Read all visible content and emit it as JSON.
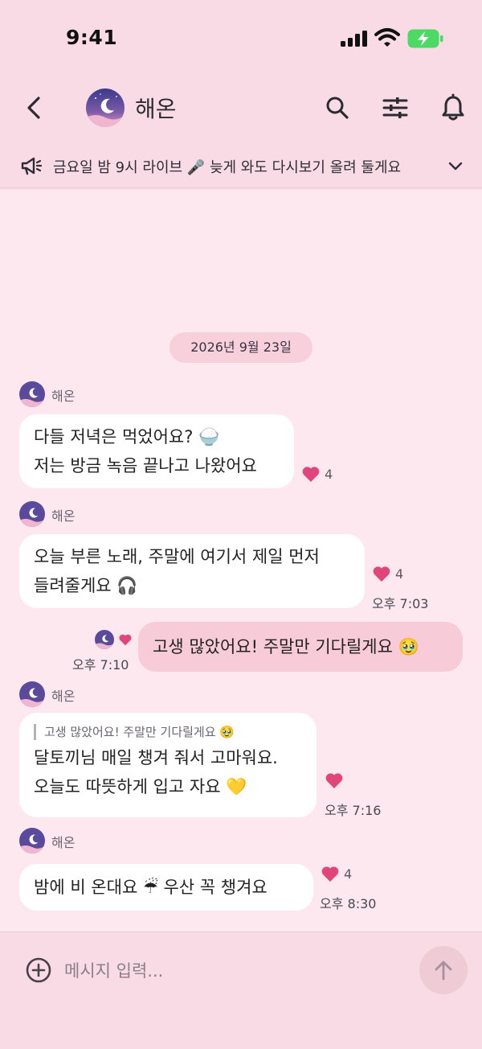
{
  "status": {
    "time": "9:41"
  },
  "header": {
    "title": "해온",
    "icons": [
      "back-chevron-icon",
      "search-icon",
      "sliders-icon",
      "bell-icon"
    ]
  },
  "announcement": {
    "text": "금요일 밤 9시 라이브 🎤 늦게 와도 다시보기 올려 둘게요"
  },
  "chat": {
    "date": "2026년 9월 23일",
    "messages": [
      {
        "sender": "해온",
        "lines": [
          "다들 저녁은 먹었어요? 🍚",
          "저는 방금 녹음 끝나고 나왔어요"
        ],
        "likes": "4",
        "time": ""
      },
      {
        "sender": "해온",
        "lines": [
          "오늘 부른 노래, 주말에 여기서 제일 먼저",
          "들려줄게요 🎧"
        ],
        "likes": "4",
        "time": "오후 7:03"
      },
      {
        "sender": "",
        "lines": [
          "고생 많았어요! 주말만 기다릴게요 🥹"
        ],
        "likes": "",
        "time": "오후 7:10"
      },
      {
        "sender": "해온",
        "quote": "고생 많았어요! 주말만 기다릴게요 🥹",
        "lines": [
          "달토끼님 매일 챙겨 줘서 고마워요.",
          "오늘도 따뜻하게 입고 자요 💛"
        ],
        "likes": "",
        "time": "오후 7:16"
      },
      {
        "sender": "해온",
        "lines": [
          "밤에 비 온대요 ☔  우산 꼭 챙겨요"
        ],
        "likes": "4",
        "time": "오후 8:30"
      }
    ]
  },
  "composer": {
    "placeholder": "메시지 입력..."
  },
  "colors": {
    "accent": "#e0467a",
    "header_bg": "#f9dbe6",
    "chat_bg": "#fde8ef",
    "my_bubble": "#f8cbd8"
  }
}
